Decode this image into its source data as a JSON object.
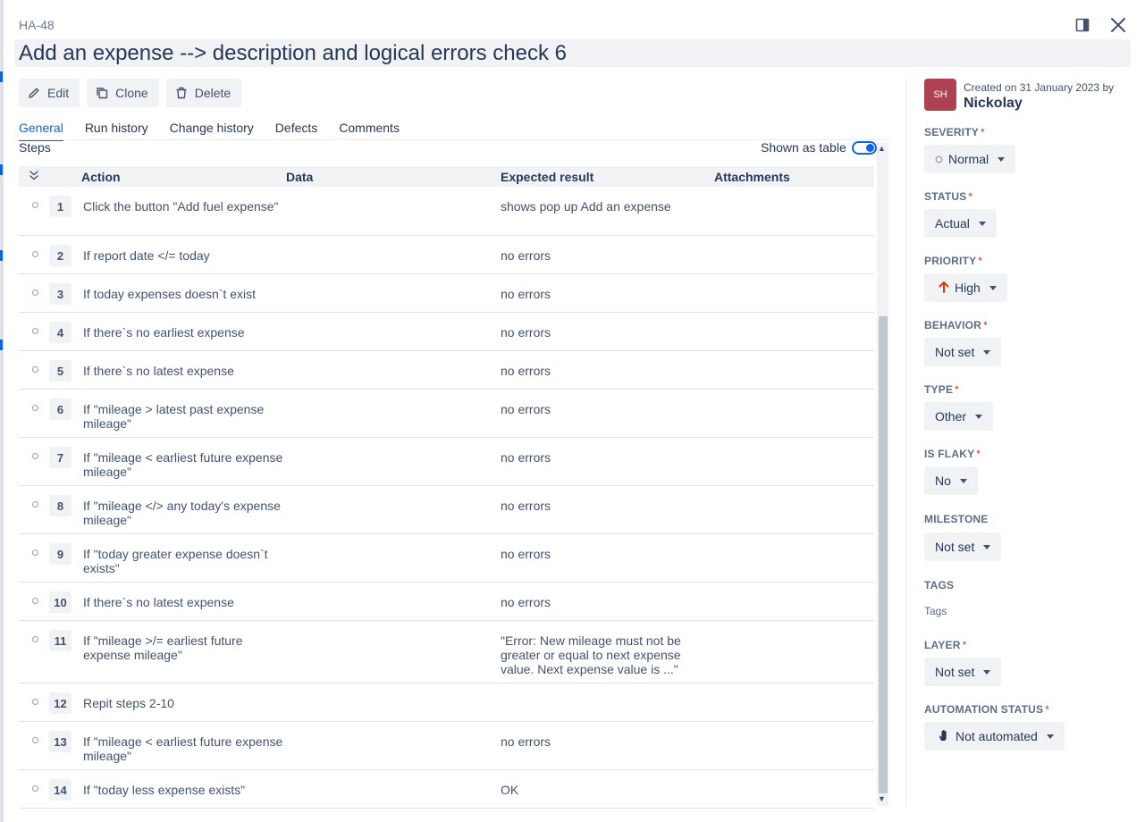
{
  "issue_key": "HA-48",
  "title": "Add an expense --> description and logical errors check 6",
  "actions": {
    "edit": "Edit",
    "clone": "Clone",
    "delete": "Delete"
  },
  "tabs": [
    "General",
    "Run history",
    "Change history",
    "Defects",
    "Comments"
  ],
  "steps_label": "Steps",
  "table_toggle_label": "Shown as table",
  "columns": {
    "action": "Action",
    "data": "Data",
    "expected": "Expected result",
    "attachments": "Attachments"
  },
  "steps": [
    {
      "num": "1",
      "action": "Click the button \"Add fuel expense\"",
      "expected": "shows pop up Add an expense"
    },
    {
      "num": "2",
      "action": "If report date </= today",
      "expected": "no errors"
    },
    {
      "num": "3",
      "action": "If today expenses doesn`t exist",
      "expected": "no errors"
    },
    {
      "num": "4",
      "action": "If there`s no earliest expense",
      "expected": "no errors"
    },
    {
      "num": "5",
      "action": "If there`s no latest expense",
      "expected": "no errors"
    },
    {
      "num": "6",
      "action": "If \"mileage > latest past expense mileage\"",
      "expected": "no errors"
    },
    {
      "num": "7",
      "action": "If \"mileage < earliest future expense mileage\"",
      "expected": "no errors"
    },
    {
      "num": "8",
      "action": "If \"mileage </> any today's expense mileage\"",
      "expected": "no errors"
    },
    {
      "num": "9",
      "action": "If \"today greater expense doesn`t exists\"",
      "expected": "no errors"
    },
    {
      "num": "10",
      "action": "If there`s no latest expense",
      "expected": "no errors"
    },
    {
      "num": "11",
      "action": "If \"mileage >/= earliest future expense mileage\"",
      "expected": "\"Error: New mileage must not be greater or equal to next expense value. Next expense value is ...\""
    },
    {
      "num": "12",
      "action": "Repit steps 2-10",
      "expected": ""
    },
    {
      "num": "13",
      "action": "If \"mileage < earliest future expense mileage\"",
      "expected": "no errors"
    },
    {
      "num": "14",
      "action": "If \"today less expense exists\"",
      "expected": "OK"
    }
  ],
  "created": {
    "avatar_initials": "SH",
    "text": "Created on 31 January 2023 by",
    "author": "Nickolay"
  },
  "fields": {
    "severity": {
      "label": "SEVERITY",
      "value": "Normal"
    },
    "status": {
      "label": "STATUS",
      "value": "Actual"
    },
    "priority": {
      "label": "PRIORITY",
      "value": "High"
    },
    "behavior": {
      "label": "BEHAVIOR",
      "value": "Not set"
    },
    "type": {
      "label": "TYPE",
      "value": "Other"
    },
    "is_flaky": {
      "label": "IS FLAKY",
      "value": "No"
    },
    "milestone": {
      "label": "MILESTONE",
      "value": "Not set"
    },
    "tags": {
      "label": "TAGS",
      "placeholder": "Tags"
    },
    "layer": {
      "label": "LAYER",
      "value": "Not set"
    },
    "automation_status": {
      "label": "AUTOMATION STATUS",
      "value": "Not automated"
    }
  },
  "colors": {
    "accent": "#0c66e4",
    "priority_high": "#de350b",
    "avatar": "#ae4152",
    "required": "#de350b"
  },
  "icons": {
    "panel": "sidebar-panel-icon",
    "close": "close-icon",
    "edit": "pencil-icon",
    "clone": "copy-icon",
    "delete": "trash-icon",
    "collapse": "double-chevron-down-icon",
    "priority": "arrow-up-icon",
    "automation": "hand-icon"
  }
}
